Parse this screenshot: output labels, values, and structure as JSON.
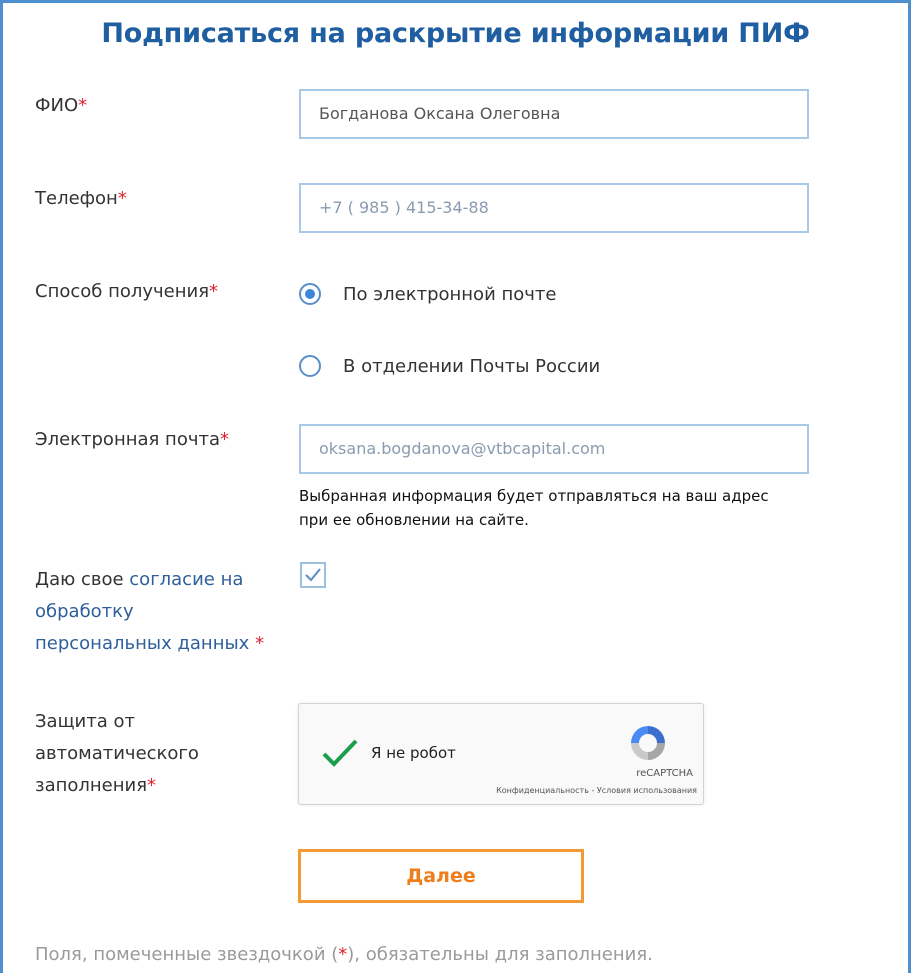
{
  "form": {
    "title": "Подписаться на раскрытие информации ПИФ",
    "required_mark": "*",
    "fio": {
      "label": "ФИО",
      "value": "Богданова Оксана Олеговна"
    },
    "phone": {
      "label": "Телефон",
      "value": "+7 ( 985 ) 415-34-88"
    },
    "delivery": {
      "label": "Способ получения",
      "options": [
        {
          "label": "По электронной почте",
          "selected": true
        },
        {
          "label": "В отделении Почты России",
          "selected": false
        }
      ]
    },
    "email": {
      "label": "Электронная почта",
      "value": "oksana.bogdanova@vtbcapital.com",
      "note_line1": "Выбранная информация будет отправляться на ваш адрес",
      "note_line2": "при ее обновлении на сайте."
    },
    "consent": {
      "prefix": "Даю свое ",
      "link_line1": "согласие на",
      "link_line2": "обработку",
      "link_line3": "персональных данных",
      "checked": true
    },
    "protection": {
      "label_line1": "Защита от",
      "label_line2": "автоматического",
      "label_line3": "заполнения"
    },
    "captcha": {
      "label": "Я не робот",
      "brand": "reCAPTCHA",
      "terms": "Конфиденциальность - Условия использования"
    },
    "submit_label": "Далее",
    "footer": {
      "before": "Поля, помеченные звездочкой (",
      "mark": "*",
      "after": "), обязательны для заполнения."
    }
  },
  "colors": {
    "title": "#1f5ea0",
    "required": "#e0232e",
    "link": "#2f5f9a",
    "input_border": "#a7c8e6",
    "button": "#f29a33",
    "checkmark": "#1a9e4a"
  }
}
